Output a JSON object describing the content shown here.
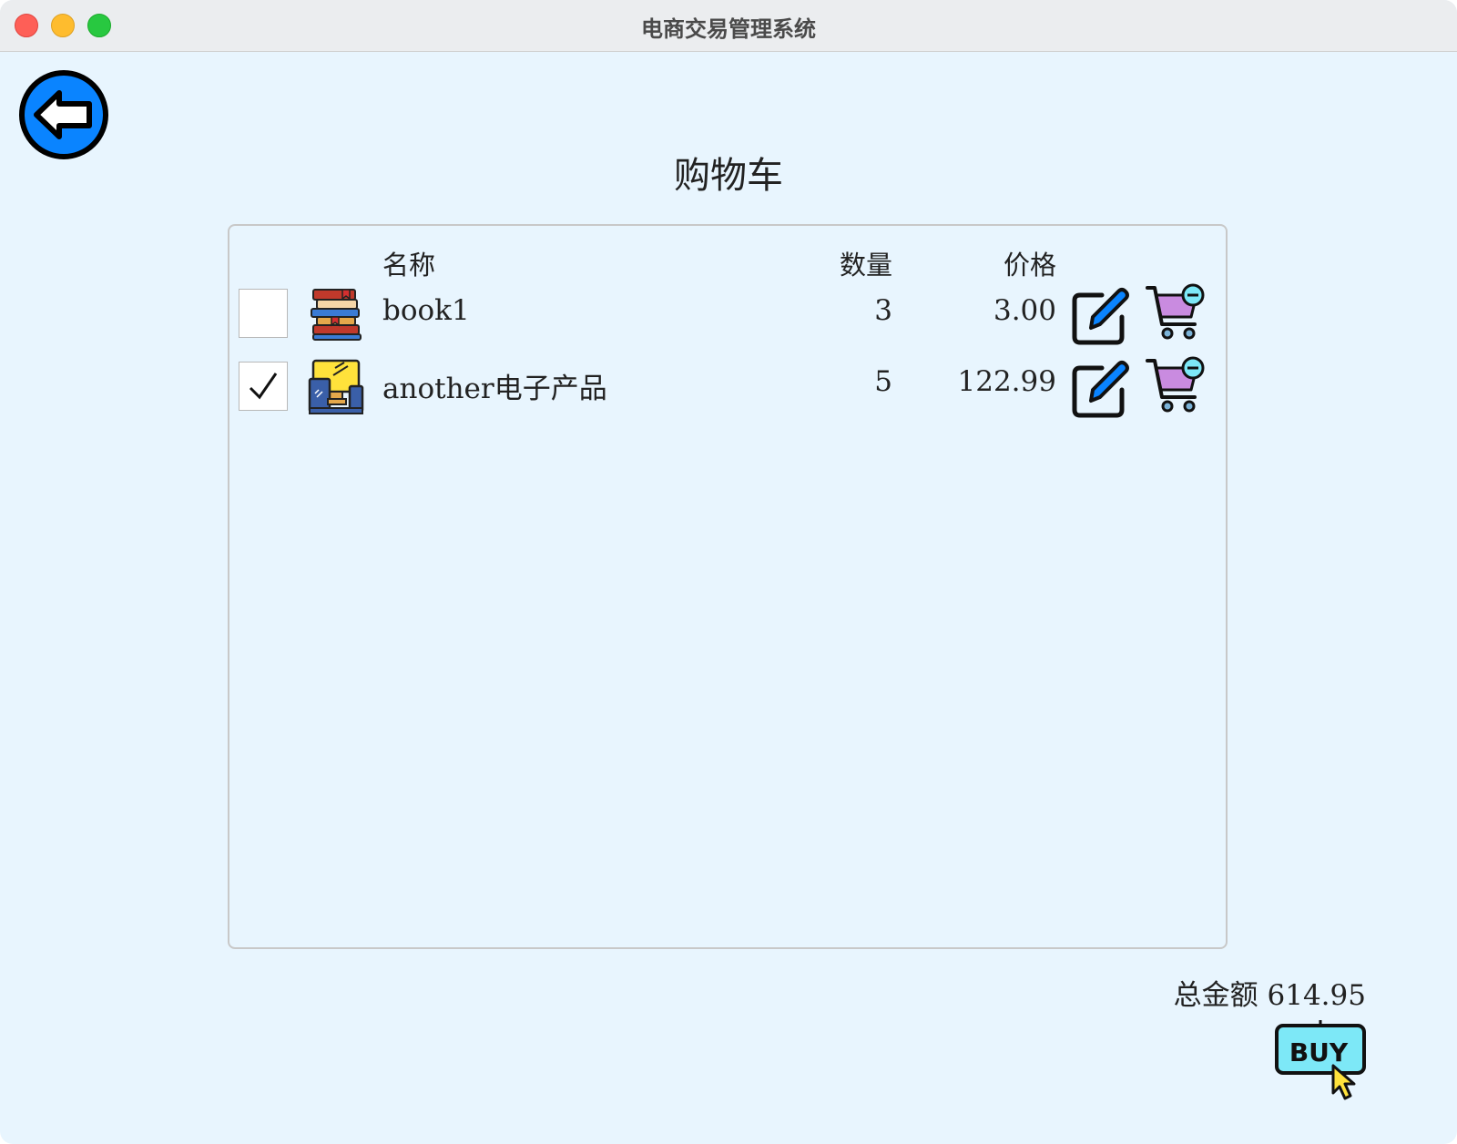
{
  "window": {
    "title": "电商交易管理系统"
  },
  "page": {
    "title": "购物车"
  },
  "table": {
    "headers": {
      "name": "名称",
      "quantity": "数量",
      "price": "价格"
    },
    "rows": [
      {
        "checked": false,
        "icon": "books-icon",
        "name": "book1",
        "quantity": "3",
        "price": "3.00"
      },
      {
        "checked": true,
        "icon": "electronics-icon",
        "name": "another电子产品",
        "quantity": "5",
        "price": "122.99"
      }
    ]
  },
  "footer": {
    "total_label": "总金额",
    "total_value": "614.95",
    "buy_label": "BUY"
  },
  "colors": {
    "background": "#e8f5fe",
    "accent": "#0a84ff",
    "cart": "#c98be0",
    "buy": "#7de8f7"
  }
}
